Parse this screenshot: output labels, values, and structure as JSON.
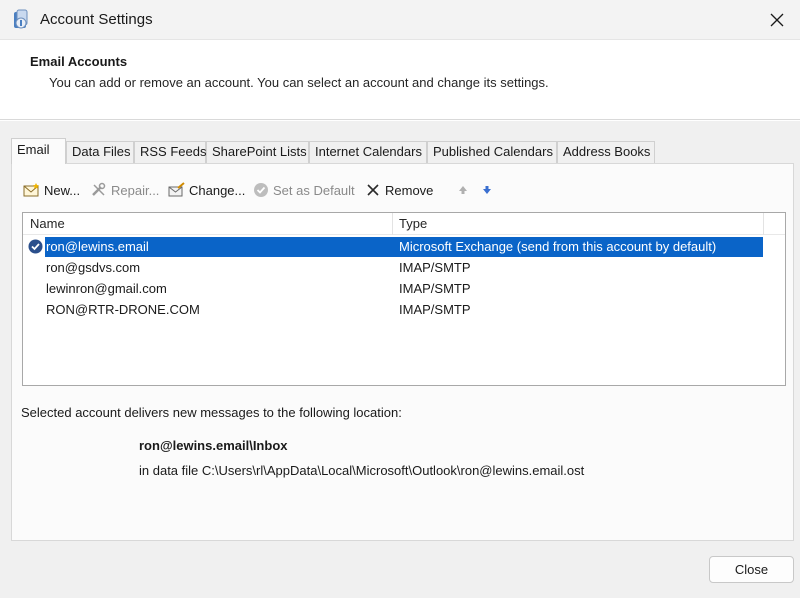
{
  "window": {
    "title": "Account Settings",
    "close_icon": "close-icon"
  },
  "header": {
    "title": "Email Accounts",
    "description": "You can add or remove an account. You can select an account and change its settings."
  },
  "tabs": [
    {
      "label": "Email",
      "active": true
    },
    {
      "label": "Data Files"
    },
    {
      "label": "RSS Feeds"
    },
    {
      "label": "SharePoint Lists"
    },
    {
      "label": "Internet Calendars"
    },
    {
      "label": "Published Calendars"
    },
    {
      "label": "Address Books"
    }
  ],
  "toolbar": {
    "new_label": "New...",
    "repair_label": "Repair...",
    "change_label": "Change...",
    "set_default_label": "Set as Default",
    "remove_label": "Remove"
  },
  "accounts": {
    "columns": {
      "name": "Name",
      "type": "Type"
    },
    "rows": [
      {
        "name": "ron@lewins.email",
        "type": "Microsoft Exchange (send from this account by default)",
        "selected": true,
        "is_default": true
      },
      {
        "name": "ron@gsdvs.com",
        "type": "IMAP/SMTP"
      },
      {
        "name": "lewinron@gmail.com",
        "type": "IMAP/SMTP"
      },
      {
        "name": "RON@RTR-DRONE.COM",
        "type": "IMAP/SMTP"
      }
    ]
  },
  "delivery": {
    "label": "Selected account delivers new messages to the following location:",
    "location": "ron@lewins.email\\Inbox",
    "data_file": "in data file C:\\Users\\rl\\AppData\\Local\\Microsoft\\Outlook\\ron@lewins.email.ost"
  },
  "footer": {
    "close_label": "Close"
  },
  "colors": {
    "selection": "#0a64c8",
    "accent": "#0067c0"
  }
}
